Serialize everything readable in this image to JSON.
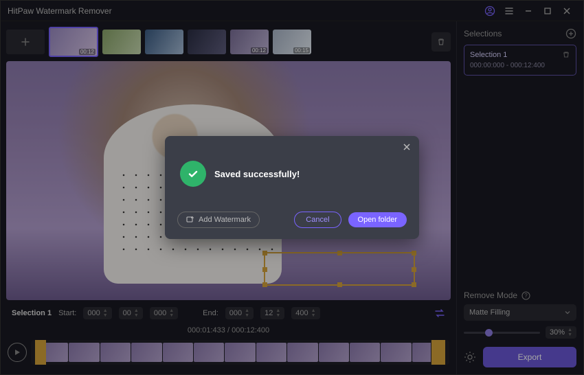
{
  "app": {
    "title": "HitPaw Watermark Remover"
  },
  "thumbs": [
    {
      "dur": "00:12"
    },
    {
      "dur": ""
    },
    {
      "dur": ""
    },
    {
      "dur": ""
    },
    {
      "dur": "00:12"
    },
    {
      "dur": "00:15"
    }
  ],
  "timebar": {
    "selection_label": "Selection 1",
    "start_label": "Start:",
    "end_label": "End:",
    "start": {
      "h": "000",
      "m": "00",
      "s": "000"
    },
    "end": {
      "h": "000",
      "m": "12",
      "s": "400"
    }
  },
  "timeline": {
    "current": "000:01:433",
    "total": "000:12:400",
    "sep": " / "
  },
  "right": {
    "selections_label": "Selections",
    "selection1": {
      "title": "Selection 1",
      "range": "000:00:000 - 000:12:400"
    },
    "mode_label": "Remove Mode",
    "mode_value": "Matte Filling",
    "strength": "30%",
    "export_label": "Export"
  },
  "dialog": {
    "message": "Saved successfully!",
    "add_watermark": "Add Watermark",
    "cancel": "Cancel",
    "open_folder": "Open folder"
  }
}
